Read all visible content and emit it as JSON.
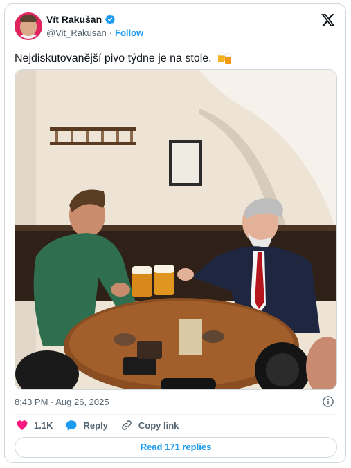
{
  "author": {
    "name": "Vít Rakušan",
    "handle": "@Vit_Rakusan",
    "separator": "·",
    "follow_label": "Follow"
  },
  "tweet": {
    "text": "Nejdiskutovanější pivo týdne je na stole.",
    "timestamp": "8:43 PM · Aug 26, 2025"
  },
  "actions": {
    "likes": "1.1K",
    "reply_label": "Reply",
    "copy_link_label": "Copy link"
  },
  "read_replies_label": "Read 171 replies",
  "colors": {
    "accent": "#1d9bf0",
    "like": "#f91880",
    "text": "#0f1419",
    "muted": "#536471"
  },
  "icons": [
    "verified-badge-icon",
    "x-logo-icon",
    "beer-mugs-emoji",
    "info-icon",
    "heart-icon",
    "reply-icon",
    "link-icon"
  ]
}
